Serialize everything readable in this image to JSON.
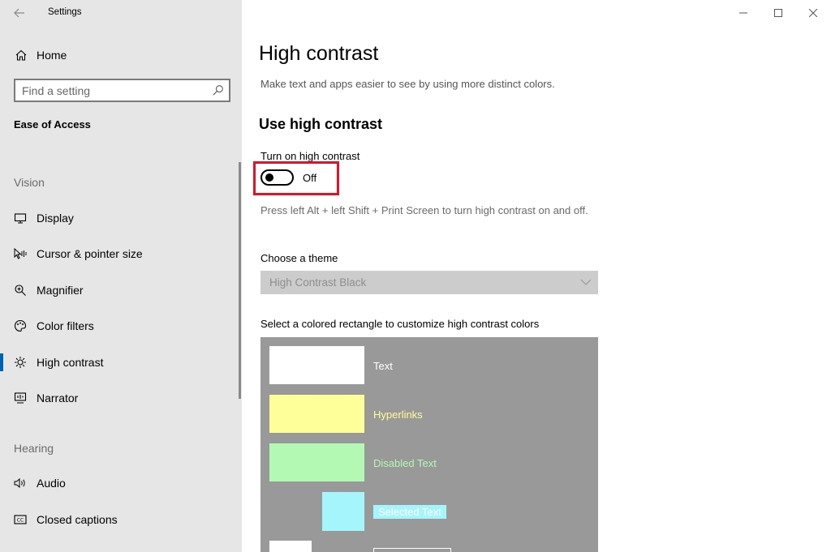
{
  "window": {
    "title": "Settings"
  },
  "sidebar": {
    "home_label": "Home",
    "search_placeholder": "Find a setting",
    "category": "Ease of Access",
    "vision_header": "Vision",
    "vision_items": [
      {
        "label": "Display",
        "icon": "display-icon"
      },
      {
        "label": "Cursor & pointer size",
        "icon": "cursor-icon"
      },
      {
        "label": "Magnifier",
        "icon": "magnifier-icon"
      },
      {
        "label": "Color filters",
        "icon": "color-filters-icon"
      },
      {
        "label": "High contrast",
        "icon": "high-contrast-icon",
        "selected": true
      },
      {
        "label": "Narrator",
        "icon": "narrator-icon"
      }
    ],
    "hearing_header": "Hearing",
    "hearing_items": [
      {
        "label": "Audio",
        "icon": "audio-icon"
      },
      {
        "label": "Closed captions",
        "icon": "closed-captions-icon"
      }
    ]
  },
  "main": {
    "title": "High contrast",
    "description": "Make text and apps easier to see by using more distinct colors.",
    "section_title": "Use high contrast",
    "toggle": {
      "label": "Turn on high contrast",
      "state_label": "Off",
      "on": false
    },
    "shortcut_hint": "Press left Alt + left Shift + Print Screen to turn high contrast on and off.",
    "theme": {
      "label": "Choose a theme",
      "selected": "High Contrast Black",
      "disabled": true
    },
    "colors": {
      "label": "Select a colored rectangle to customize high contrast colors",
      "items": [
        {
          "label": "Text",
          "color": "#ffffff",
          "label_color": "#ffffff"
        },
        {
          "label": "Hyperlinks",
          "color": "#ffff99",
          "label_color": "#ffff99"
        },
        {
          "label": "Disabled Text",
          "color": "#b3f8b3",
          "label_color": "#b3f8b3"
        },
        {
          "label": "Selected Text",
          "color": "#a5f5fc",
          "label_color": "#ffffff",
          "label_bg": "#a5f5fc"
        }
      ]
    }
  },
  "colors": {
    "sidebar_bg": "#e6e6e6",
    "accent": "#0063b1",
    "highlight_box": "#e81123",
    "panel_bg": "#999999"
  }
}
